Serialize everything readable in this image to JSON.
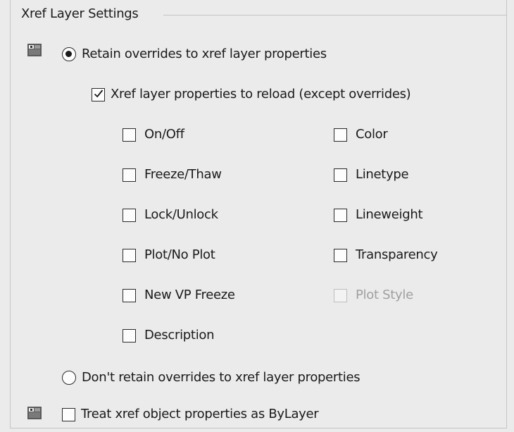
{
  "group": {
    "title": "Xref Layer Settings"
  },
  "options": {
    "retain": {
      "label": "Retain overrides to xref layer properties",
      "selected": true
    },
    "reload": {
      "label": "Xref layer properties to reload (except overrides)",
      "checked": true
    },
    "dont_retain": {
      "label": "Don't retain overrides to xref layer properties",
      "selected": false
    },
    "treat_bylayer": {
      "label": "Treat xref object properties as ByLayer",
      "checked": false
    }
  },
  "properties": {
    "left": [
      {
        "label": "On/Off",
        "checked": false
      },
      {
        "label": "Freeze/Thaw",
        "checked": false
      },
      {
        "label": "Lock/Unlock",
        "checked": false
      },
      {
        "label": "Plot/No Plot",
        "checked": false
      },
      {
        "label": "New VP Freeze",
        "checked": false
      },
      {
        "label": "Description",
        "checked": false
      }
    ],
    "right": [
      {
        "label": "Color",
        "checked": false
      },
      {
        "label": "Linetype",
        "checked": false
      },
      {
        "label": "Lineweight",
        "checked": false
      },
      {
        "label": "Transparency",
        "checked": false
      },
      {
        "label": "Plot Style",
        "checked": false,
        "disabled": true
      }
    ]
  },
  "icons": {
    "layer_icon_1": "layer-properties-icon",
    "layer_icon_2": "layer-properties-icon"
  }
}
